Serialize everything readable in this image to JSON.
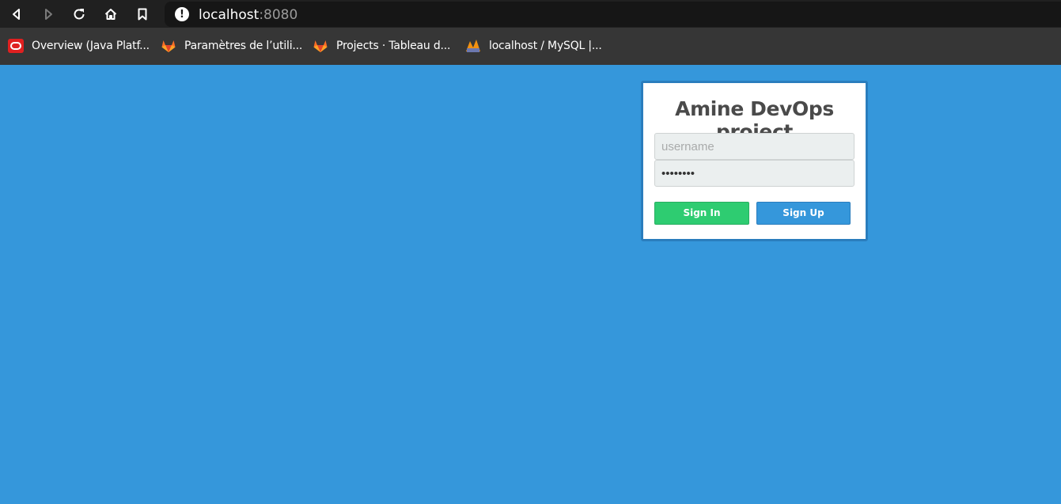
{
  "browser": {
    "url_host": "localhost",
    "url_port": ":8080",
    "nav_icons": [
      "back-icon",
      "forward-icon",
      "reload-icon",
      "home-icon",
      "bookmark-icon"
    ],
    "bookmarks": [
      {
        "label": "Overview (Java Platf...",
        "icon": "oracle-icon"
      },
      {
        "label": "Paramètres de l’utili...",
        "icon": "gitlab-icon"
      },
      {
        "label": "Projects · Tableau d...",
        "icon": "gitlab-icon"
      },
      {
        "label": "localhost / MySQL |...",
        "icon": "phpmyadmin-icon"
      }
    ]
  },
  "login": {
    "title": "Amine DevOps project",
    "username_placeholder": "username",
    "password_value": "••••••••",
    "signin_label": "Sign In",
    "signup_label": "Sign Up"
  },
  "colors": {
    "page_background": "#3597db",
    "signin": "#2ecc71",
    "signup": "#3597db"
  }
}
